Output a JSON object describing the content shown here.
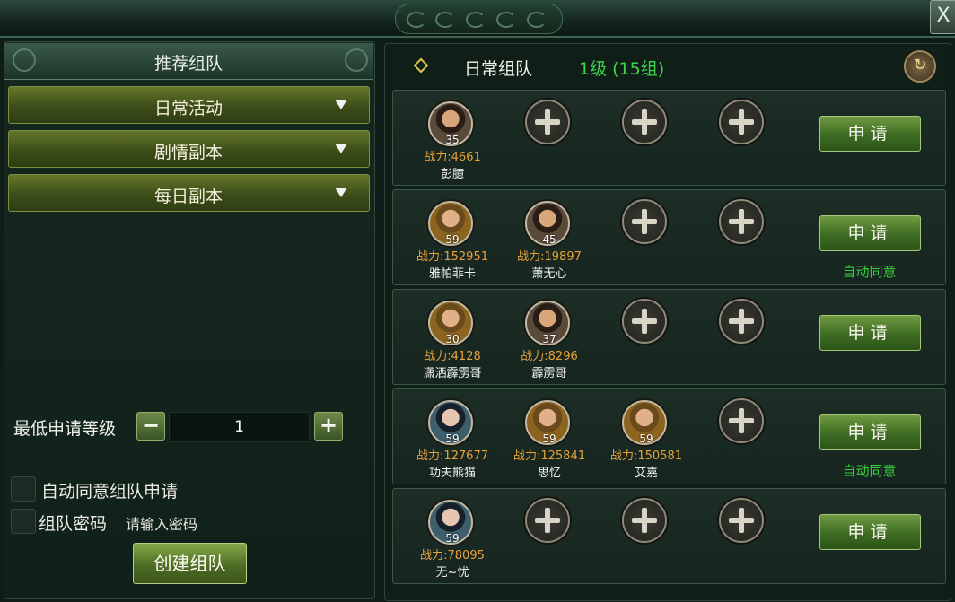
{
  "window": {
    "close_label": "X"
  },
  "left": {
    "title": "推荐组队",
    "dropdowns": [
      "日常活动",
      "剧情副本",
      "每日副本"
    ],
    "min_level_label": "最低申请等级",
    "min_level_value": "1",
    "minus_label": "−",
    "plus_label": "+",
    "auto_agree_label": "自动同意组队申请",
    "password_label": "组队密码",
    "password_placeholder": "请输入密码",
    "create_label": "创建组队"
  },
  "right": {
    "title": "日常组队",
    "level_info": "1级 (15组)",
    "apply_label": "申请",
    "auto_agree_text": "自动同意",
    "rows": [
      {
        "members": [
          {
            "level": "35",
            "power": "战力:4661",
            "name": "彭臆",
            "style": "brown"
          }
        ],
        "auto_agree": false
      },
      {
        "members": [
          {
            "level": "59",
            "power": "战力:152951",
            "name": "雅帕菲卡",
            "style": "gold"
          },
          {
            "level": "45",
            "power": "战力:19897",
            "name": "萧无心",
            "style": "brown"
          }
        ],
        "auto_agree": true
      },
      {
        "members": [
          {
            "level": "30",
            "power": "战力:4128",
            "name": "潇洒霹雳哥",
            "style": "gold"
          },
          {
            "level": "37",
            "power": "战力:8296",
            "name": "霹雳哥",
            "style": "brown"
          }
        ],
        "auto_agree": false
      },
      {
        "members": [
          {
            "level": "59",
            "power": "战力:127677",
            "name": "功夫熊猫",
            "style": "blue"
          },
          {
            "level": "59",
            "power": "战力:125841",
            "name": "思忆",
            "style": "gold"
          },
          {
            "level": "59",
            "power": "战力:150581",
            "name": "艾嘉",
            "style": "gold"
          }
        ],
        "auto_agree": true
      },
      {
        "members": [
          {
            "level": "59",
            "power": "战力:78095",
            "name": "无~忧",
            "style": "blue"
          }
        ],
        "auto_agree": false
      }
    ]
  }
}
